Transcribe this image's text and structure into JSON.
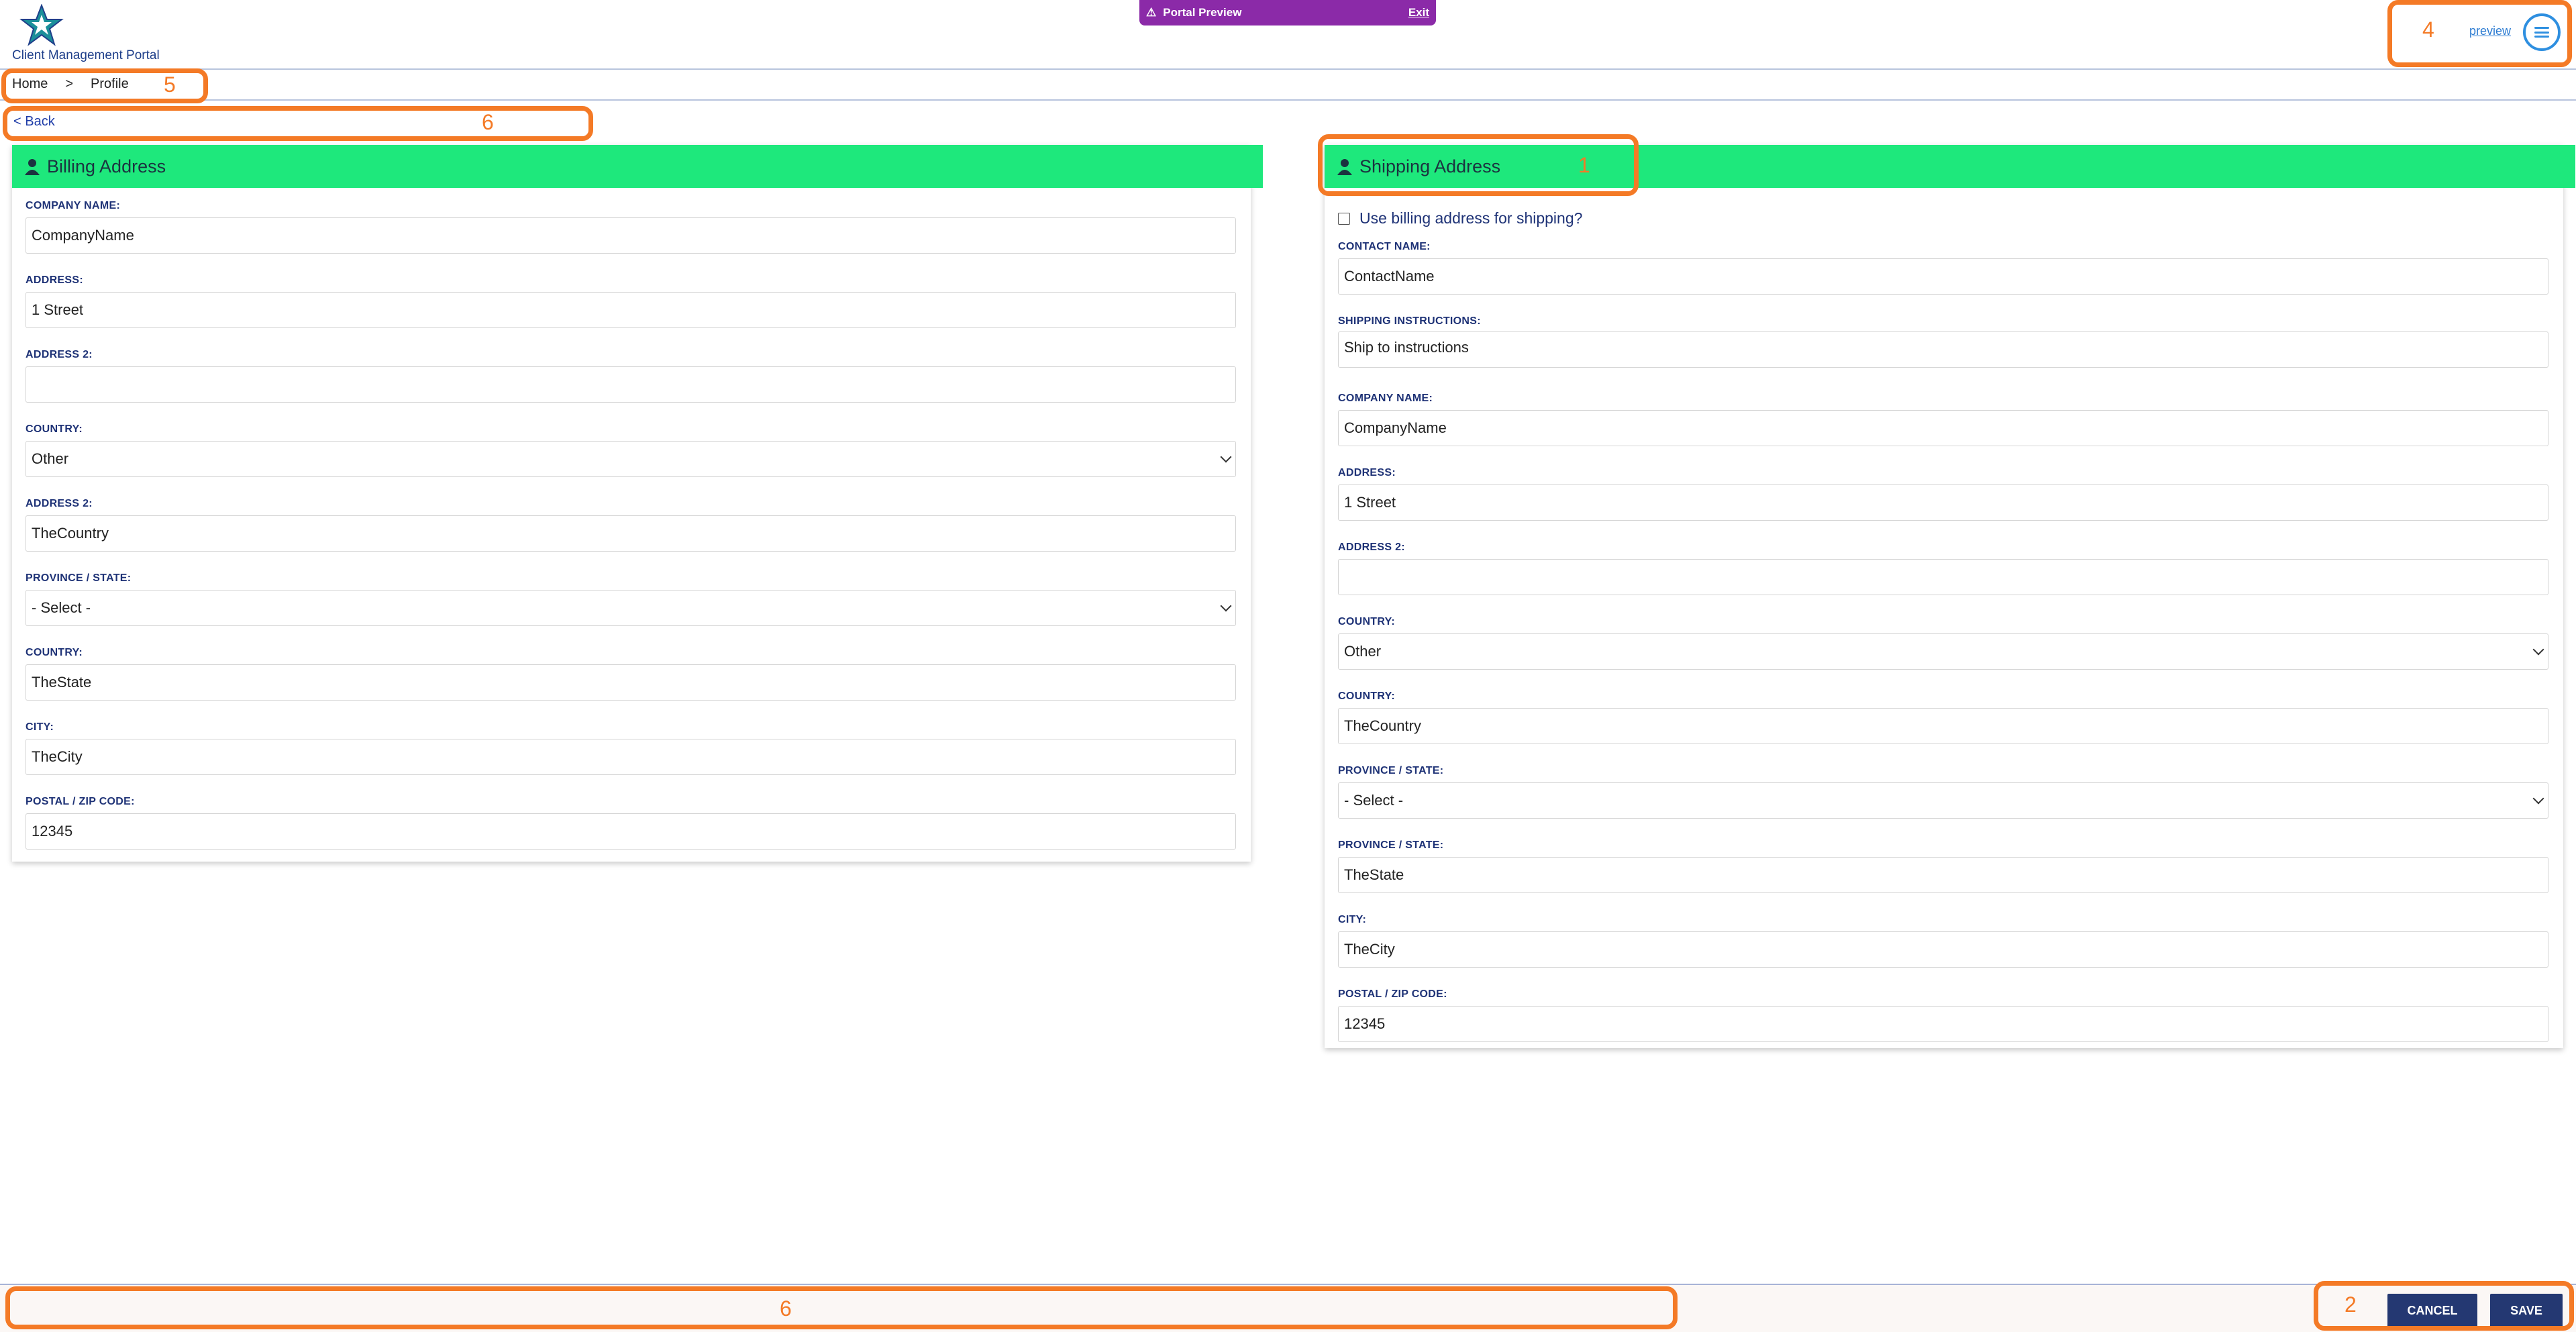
{
  "header": {
    "logo_text": "Client Management Portal",
    "banner_title": "Portal Preview",
    "banner_exit": "Exit",
    "preview_link": "preview"
  },
  "breadcrumb": {
    "home": "Home",
    "separator": ">",
    "current": "Profile"
  },
  "back_link": "< Back",
  "billing": {
    "title": "Billing Address",
    "fields": [
      {
        "label": "COMPANY NAME:",
        "value": "CompanyName"
      },
      {
        "label": "ADDRESS:",
        "value": "1 Street"
      },
      {
        "label": "ADDRESS 2:",
        "value": ""
      },
      {
        "label": "COUNTRY:",
        "value": "Other"
      },
      {
        "label": "ADDRESS 2:",
        "value": "TheCountry"
      },
      {
        "label": "PROVINCE / STATE:",
        "value": "- Select -"
      },
      {
        "label": "COUNTRY:",
        "value": "TheState"
      },
      {
        "label": "CITY:",
        "value": "TheCity"
      },
      {
        "label": "POSTAL / ZIP CODE:",
        "value": "12345"
      }
    ]
  },
  "shipping": {
    "title": "Shipping Address",
    "checkbox_label": "Use billing address for shipping?",
    "fields": [
      {
        "label": "CONTACT NAME:",
        "value": "ContactName"
      },
      {
        "label": "SHIPPING INSTRUCTIONS:",
        "value": "Ship to instructions"
      },
      {
        "label": "COMPANY NAME:",
        "value": "CompanyName"
      },
      {
        "label": "ADDRESS:",
        "value": "1 Street"
      },
      {
        "label": "ADDRESS 2:",
        "value": ""
      },
      {
        "label": "COUNTRY:",
        "value": "Other"
      },
      {
        "label": "COUNTRY:",
        "value": "TheCountry"
      },
      {
        "label": "PROVINCE / STATE:",
        "value": "- Select -"
      },
      {
        "label": "PROVINCE / STATE:",
        "value": "TheState"
      },
      {
        "label": "CITY:",
        "value": "TheCity"
      },
      {
        "label": "POSTAL / ZIP CODE:",
        "value": "12345"
      }
    ]
  },
  "footer": {
    "cancel_label": "CANCEL",
    "save_label": "SAVE"
  },
  "annotations": {
    "n1": "1",
    "n2": "2",
    "n4": "4",
    "n5": "5",
    "n6a": "6",
    "n6b": "6",
    "color": "#f47a26"
  },
  "colors": {
    "panel_header": "#1ee87c",
    "banner": "#8b2aa8",
    "button": "#243872",
    "label": "#1e3276"
  },
  "icons": {
    "logo": "star-icon",
    "menu": "hamburger-icon",
    "panel": "person-icon",
    "banner": "warning-icon"
  }
}
